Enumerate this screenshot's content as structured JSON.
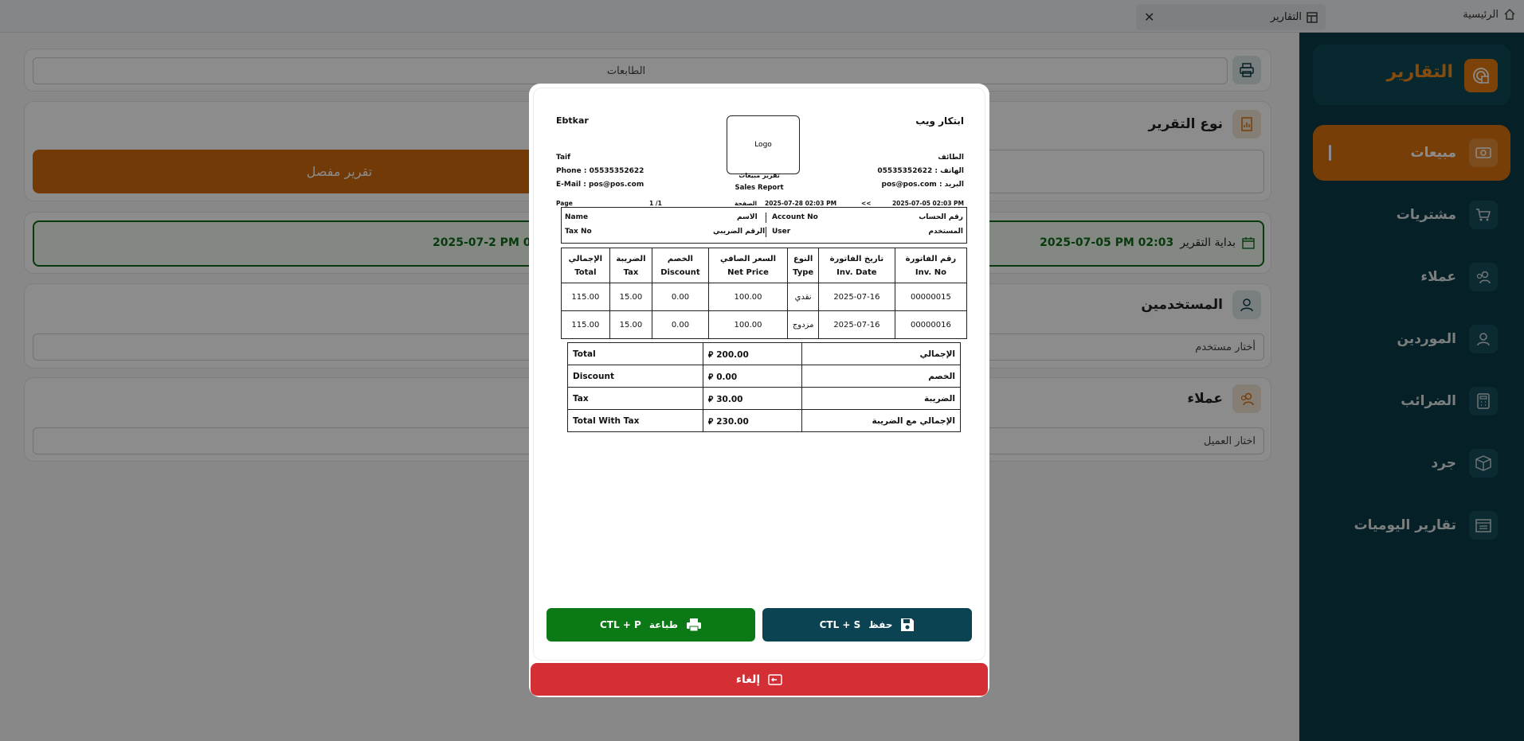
{
  "topbar": {
    "home_label": "الرئيسية",
    "tab_label": "التقارير",
    "close_symbol": "✕"
  },
  "sidebar": {
    "title": "التقارير",
    "items": [
      {
        "label": "مبيعات",
        "icon": "money-icon",
        "active": true
      },
      {
        "label": "مشتريات",
        "icon": "cart-icon",
        "active": false
      },
      {
        "label": "عملاء",
        "icon": "users-icon",
        "active": false
      },
      {
        "label": "الموردين",
        "icon": "user-icon",
        "active": false
      },
      {
        "label": "الضرائب",
        "icon": "calculator-icon",
        "active": false
      },
      {
        "label": "جرد",
        "icon": "box-icon",
        "active": false
      },
      {
        "label": "تقارير اليوميات",
        "icon": "calendar-icon",
        "active": false
      }
    ]
  },
  "main": {
    "printers_placeholder": "الطابعات",
    "report_type_title": "نوع التقرير",
    "detailed_report_label": "تقرير مفصل",
    "start_label": "بداية التقرير",
    "start_date": "2025-07-05  PM 02:03",
    "end_date_partial": "2025-07-2  PM 02:03",
    "users_title": "المستخدمين",
    "user_select_placeholder": "أختار مستخدم",
    "clients_title": "عملاء",
    "client_select_placeholder": "اختار العميل"
  },
  "invoice": {
    "company_en": "Ebtkar",
    "company_ar": "ابتكار ويب",
    "logo_label": "Logo",
    "city_en": "Taif",
    "city_ar": "الطائف",
    "phone_en": "Phone : 05535352622",
    "phone_ar": "الهاتف : 05535352622",
    "email_en": "E-Mail : pos@pos.com",
    "email_ar": "البريد : pos@pos.com",
    "report_ar": "تقرير مبيعات",
    "report_en": "Sales Report",
    "page_en": "Page",
    "page_num": "1 /1",
    "page_ar": "الصفحة",
    "date_to": "2025-07-28 02:03 PM",
    "arrows": "<<",
    "date_from": "2025-07-05 02:03 PM",
    "info": {
      "name_en": "Name",
      "name_ar": "الاسم",
      "account_en": "Account No",
      "account_ar": "رقم الحساب",
      "taxno_en": "Tax No",
      "taxno_ar": "الرقم الضريبي",
      "user_en": "User",
      "user_ar": "المستخدم"
    },
    "columns": [
      {
        "ar": "رقم الفاتورة",
        "en": "Inv. No"
      },
      {
        "ar": "تاريخ الفاتورة",
        "en": "Inv. Date"
      },
      {
        "ar": "النوع",
        "en": "Type"
      },
      {
        "ar": "السعر الصافي",
        "en": "Net Price"
      },
      {
        "ar": "الخصم",
        "en": "Discount"
      },
      {
        "ar": "الضريبة",
        "en": "Tax"
      },
      {
        "ar": "الإجمالي",
        "en": "Total"
      }
    ],
    "rows": [
      [
        "00000015",
        "2025-07-16",
        "نقدي",
        "100.00",
        "0.00",
        "15.00",
        "115.00"
      ],
      [
        "00000016",
        "2025-07-16",
        "مزدوج",
        "100.00",
        "0.00",
        "15.00",
        "115.00"
      ]
    ],
    "currency_symbol": "⃁",
    "totals": [
      {
        "en": "Total",
        "value": "200.00",
        "ar": "الإجمالي"
      },
      {
        "en": "Discount",
        "value": "0.00",
        "ar": "الخصم"
      },
      {
        "en": "Tax",
        "value": "30.00",
        "ar": "الضريبة"
      },
      {
        "en": "Total With Tax",
        "value": "230.00",
        "ar": "الإجمالي مع الضريبة"
      }
    ]
  },
  "buttons": {
    "print_label": "طباعة",
    "print_shortcut": "CTL + P",
    "save_label": "حفظ",
    "save_shortcut": "CTL + S",
    "cancel_label": "إلغاء"
  },
  "colors": {
    "sidebar_bg": "#0a3b47",
    "accent_orange": "#d9720e",
    "print_green": "#0b7a16",
    "save_teal": "#0b4352",
    "cancel_red": "#d32f34"
  }
}
